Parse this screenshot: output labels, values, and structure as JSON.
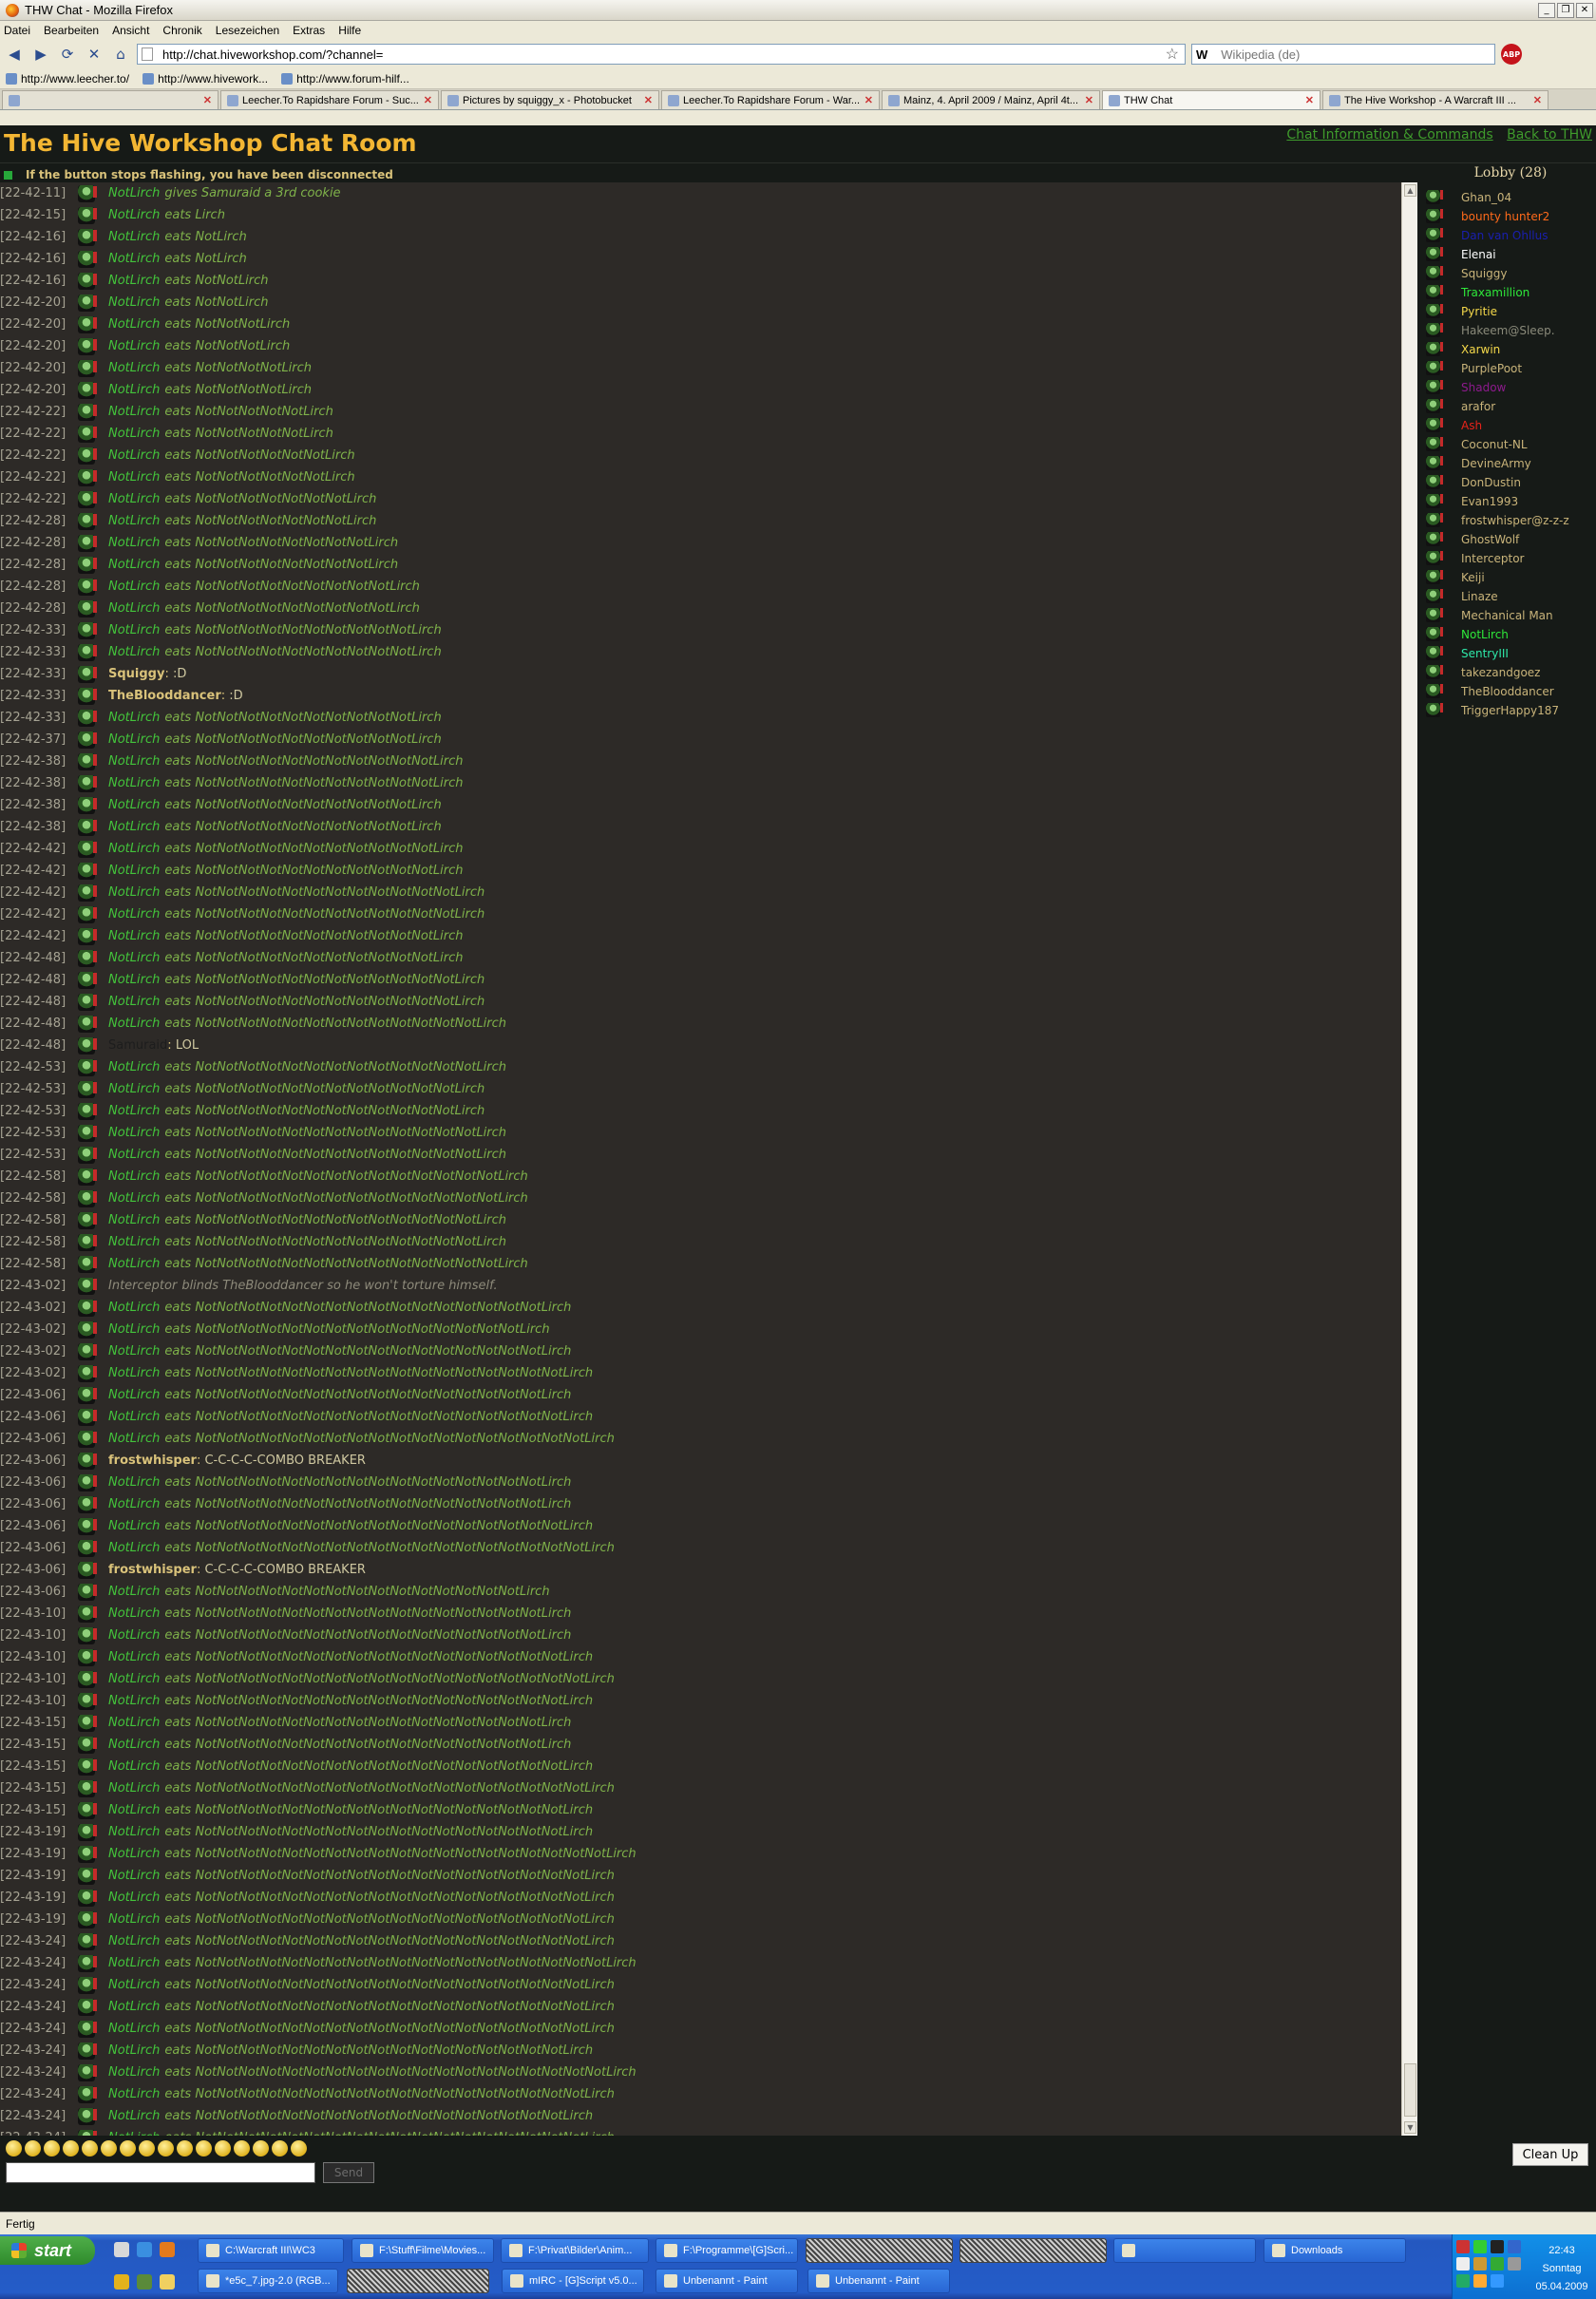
{
  "window": {
    "title": "THW Chat - Mozilla Firefox",
    "controls": [
      "_",
      "❐",
      "✕"
    ]
  },
  "menu": [
    "Datei",
    "Bearbeiten",
    "Ansicht",
    "Chronik",
    "Lesezeichen",
    "Extras",
    "Hilfe"
  ],
  "nav": {
    "url": "http://chat.hiveworkshop.com/?channel=",
    "search_engine": "W",
    "search_placeholder": "Wikipedia (de)",
    "adblock_label": "ABP"
  },
  "bookmarks": [
    "http://www.leecher.to/",
    "http://www.hivework...",
    "http://www.forum-hilf..."
  ],
  "tabs": [
    {
      "label": "",
      "active": false
    },
    {
      "label": "Leecher.To Rapidshare Forum - Suc...",
      "active": false
    },
    {
      "label": "Pictures by squiggy_x - Photobucket",
      "active": false
    },
    {
      "label": "Leecher.To Rapidshare Forum - War...",
      "active": false
    },
    {
      "label": "Mainz, 4. April 2009 / Mainz, April 4t...",
      "active": false
    },
    {
      "label": "THW Chat",
      "active": true
    },
    {
      "label": "The Hive Workshop - A Warcraft III ...",
      "active": false
    }
  ],
  "chat": {
    "title": "The Hive Workshop Chat Room",
    "links": [
      "Chat Information & Commands",
      "Back to THW"
    ],
    "notice": "If the button stops flashing, you have been disconnected",
    "lobby": "Lobby (28)"
  },
  "messages": [
    {
      "ts": "[22-42-11]",
      "kind": "emote",
      "nick": "NotLirch",
      "text": "gives Samuraid a 3rd cookie"
    },
    {
      "ts": "[22-42-15]",
      "kind": "emote",
      "nick": "NotLirch",
      "text": "eats Lirch"
    },
    {
      "ts": "[22-42-16]",
      "kind": "emote",
      "nick": "NotLirch",
      "text": "eats NotLirch"
    },
    {
      "ts": "[22-42-16]",
      "kind": "emote",
      "nick": "NotLirch",
      "text": "eats NotLirch"
    },
    {
      "ts": "[22-42-16]",
      "kind": "emote",
      "nick": "NotLirch",
      "text": "eats NotNotLirch"
    },
    {
      "ts": "[22-42-20]",
      "kind": "emote",
      "nick": "NotLirch",
      "text": "eats NotNotLirch"
    },
    {
      "ts": "[22-42-20]",
      "kind": "emote",
      "nick": "NotLirch",
      "text": "eats NotNotNotLirch"
    },
    {
      "ts": "[22-42-20]",
      "kind": "emote",
      "nick": "NotLirch",
      "text": "eats NotNotNotLirch"
    },
    {
      "ts": "[22-42-20]",
      "kind": "emote",
      "nick": "NotLirch",
      "text": "eats NotNotNotNotLirch"
    },
    {
      "ts": "[22-42-20]",
      "kind": "emote",
      "nick": "NotLirch",
      "text": "eats NotNotNotNotLirch"
    },
    {
      "ts": "[22-42-22]",
      "kind": "emote",
      "nick": "NotLirch",
      "text": "eats NotNotNotNotNotLirch"
    },
    {
      "ts": "[22-42-22]",
      "kind": "emote",
      "nick": "NotLirch",
      "text": "eats NotNotNotNotNotLirch"
    },
    {
      "ts": "[22-42-22]",
      "kind": "emote",
      "nick": "NotLirch",
      "text": "eats NotNotNotNotNotNotLirch"
    },
    {
      "ts": "[22-42-22]",
      "kind": "emote",
      "nick": "NotLirch",
      "text": "eats NotNotNotNotNotNotLirch"
    },
    {
      "ts": "[22-42-22]",
      "kind": "emote",
      "nick": "NotLirch",
      "text": "eats NotNotNotNotNotNotNotLirch"
    },
    {
      "ts": "[22-42-28]",
      "kind": "emote",
      "nick": "NotLirch",
      "text": "eats NotNotNotNotNotNotNotLirch"
    },
    {
      "ts": "[22-42-28]",
      "kind": "emote",
      "nick": "NotLirch",
      "text": "eats NotNotNotNotNotNotNotNotLirch"
    },
    {
      "ts": "[22-42-28]",
      "kind": "emote",
      "nick": "NotLirch",
      "text": "eats NotNotNotNotNotNotNotNotLirch"
    },
    {
      "ts": "[22-42-28]",
      "kind": "emote",
      "nick": "NotLirch",
      "text": "eats NotNotNotNotNotNotNotNotNotLirch"
    },
    {
      "ts": "[22-42-28]",
      "kind": "emote",
      "nick": "NotLirch",
      "text": "eats NotNotNotNotNotNotNotNotNotLirch"
    },
    {
      "ts": "[22-42-33]",
      "kind": "emote",
      "nick": "NotLirch",
      "text": "eats NotNotNotNotNotNotNotNotNotNotLirch"
    },
    {
      "ts": "[22-42-33]",
      "kind": "emote",
      "nick": "NotLirch",
      "text": "eats NotNotNotNotNotNotNotNotNotNotLirch"
    },
    {
      "ts": "[22-42-33]",
      "kind": "say",
      "nick": "Squiggy",
      "text": ":D"
    },
    {
      "ts": "[22-42-33]",
      "kind": "say",
      "nick": "TheBlooddancer",
      "text": ":D"
    },
    {
      "ts": "[22-42-33]",
      "kind": "emote",
      "nick": "NotLirch",
      "text": "eats NotNotNotNotNotNotNotNotNotNotLirch"
    },
    {
      "ts": "[22-42-37]",
      "kind": "emote",
      "nick": "NotLirch",
      "text": "eats NotNotNotNotNotNotNotNotNotNotLirch"
    },
    {
      "ts": "[22-42-38]",
      "kind": "emote",
      "nick": "NotLirch",
      "text": "eats NotNotNotNotNotNotNotNotNotNotNotLirch"
    },
    {
      "ts": "[22-42-38]",
      "kind": "emote",
      "nick": "NotLirch",
      "text": "eats NotNotNotNotNotNotNotNotNotNotNotLirch"
    },
    {
      "ts": "[22-42-38]",
      "kind": "emote",
      "nick": "NotLirch",
      "text": "eats NotNotNotNotNotNotNotNotNotNotLirch"
    },
    {
      "ts": "[22-42-38]",
      "kind": "emote",
      "nick": "NotLirch",
      "text": "eats NotNotNotNotNotNotNotNotNotNotLirch"
    },
    {
      "ts": "[22-42-42]",
      "kind": "emote",
      "nick": "NotLirch",
      "text": "eats NotNotNotNotNotNotNotNotNotNotNotLirch"
    },
    {
      "ts": "[22-42-42]",
      "kind": "emote",
      "nick": "NotLirch",
      "text": "eats NotNotNotNotNotNotNotNotNotNotNotLirch"
    },
    {
      "ts": "[22-42-42]",
      "kind": "emote",
      "nick": "NotLirch",
      "text": "eats NotNotNotNotNotNotNotNotNotNotNotNotLirch"
    },
    {
      "ts": "[22-42-42]",
      "kind": "emote",
      "nick": "NotLirch",
      "text": "eats NotNotNotNotNotNotNotNotNotNotNotNotLirch"
    },
    {
      "ts": "[22-42-42]",
      "kind": "emote",
      "nick": "NotLirch",
      "text": "eats NotNotNotNotNotNotNotNotNotNotNotLirch"
    },
    {
      "ts": "[22-42-48]",
      "kind": "emote",
      "nick": "NotLirch",
      "text": "eats NotNotNotNotNotNotNotNotNotNotNotLirch"
    },
    {
      "ts": "[22-42-48]",
      "kind": "emote",
      "nick": "NotLirch",
      "text": "eats NotNotNotNotNotNotNotNotNotNotNotNotLirch"
    },
    {
      "ts": "[22-42-48]",
      "kind": "emote",
      "nick": "NotLirch",
      "text": "eats NotNotNotNotNotNotNotNotNotNotNotNotLirch"
    },
    {
      "ts": "[22-42-48]",
      "kind": "emote",
      "nick": "NotLirch",
      "text": "eats NotNotNotNotNotNotNotNotNotNotNotNotNotLirch"
    },
    {
      "ts": "[22-42-48]",
      "kind": "say-dark",
      "nick": "Samuraid",
      "text": "LOL"
    },
    {
      "ts": "[22-42-53]",
      "kind": "emote",
      "nick": "NotLirch",
      "text": "eats NotNotNotNotNotNotNotNotNotNotNotNotNotLirch"
    },
    {
      "ts": "[22-42-53]",
      "kind": "emote",
      "nick": "NotLirch",
      "text": "eats NotNotNotNotNotNotNotNotNotNotNotNotLirch"
    },
    {
      "ts": "[22-42-53]",
      "kind": "emote",
      "nick": "NotLirch",
      "text": "eats NotNotNotNotNotNotNotNotNotNotNotNotLirch"
    },
    {
      "ts": "[22-42-53]",
      "kind": "emote",
      "nick": "NotLirch",
      "text": "eats NotNotNotNotNotNotNotNotNotNotNotNotNotLirch"
    },
    {
      "ts": "[22-42-53]",
      "kind": "emote",
      "nick": "NotLirch",
      "text": "eats NotNotNotNotNotNotNotNotNotNotNotNotNotLirch"
    },
    {
      "ts": "[22-42-58]",
      "kind": "emote",
      "nick": "NotLirch",
      "text": "eats NotNotNotNotNotNotNotNotNotNotNotNotNotNotLirch"
    },
    {
      "ts": "[22-42-58]",
      "kind": "emote",
      "nick": "NotLirch",
      "text": "eats NotNotNotNotNotNotNotNotNotNotNotNotNotNotLirch"
    },
    {
      "ts": "[22-42-58]",
      "kind": "emote",
      "nick": "NotLirch",
      "text": "eats NotNotNotNotNotNotNotNotNotNotNotNotNotLirch"
    },
    {
      "ts": "[22-42-58]",
      "kind": "emote",
      "nick": "NotLirch",
      "text": "eats NotNotNotNotNotNotNotNotNotNotNotNotNotLirch"
    },
    {
      "ts": "[22-42-58]",
      "kind": "emote",
      "nick": "NotLirch",
      "text": "eats NotNotNotNotNotNotNotNotNotNotNotNotNotNotLirch"
    },
    {
      "ts": "[22-43-02]",
      "kind": "emote-gray",
      "nick": "Interceptor",
      "text": "blinds TheBlooddancer so he won't torture himself."
    },
    {
      "ts": "[22-43-02]",
      "kind": "emote",
      "nick": "NotLirch",
      "text": "eats NotNotNotNotNotNotNotNotNotNotNotNotNotNotNotNotLirch"
    },
    {
      "ts": "[22-43-02]",
      "kind": "emote",
      "nick": "NotLirch",
      "text": "eats NotNotNotNotNotNotNotNotNotNotNotNotNotNotNotLirch"
    },
    {
      "ts": "[22-43-02]",
      "kind": "emote",
      "nick": "NotLirch",
      "text": "eats NotNotNotNotNotNotNotNotNotNotNotNotNotNotNotNotLirch"
    },
    {
      "ts": "[22-43-02]",
      "kind": "emote",
      "nick": "NotLirch",
      "text": "eats NotNotNotNotNotNotNotNotNotNotNotNotNotNotNotNotNotLirch"
    },
    {
      "ts": "[22-43-06]",
      "kind": "emote",
      "nick": "NotLirch",
      "text": "eats NotNotNotNotNotNotNotNotNotNotNotNotNotNotNotNotLirch"
    },
    {
      "ts": "[22-43-06]",
      "kind": "emote",
      "nick": "NotLirch",
      "text": "eats NotNotNotNotNotNotNotNotNotNotNotNotNotNotNotNotNotLirch"
    },
    {
      "ts": "[22-43-06]",
      "kind": "emote",
      "nick": "NotLirch",
      "text": "eats NotNotNotNotNotNotNotNotNotNotNotNotNotNotNotNotNotNotLirch"
    },
    {
      "ts": "[22-43-06]",
      "kind": "say",
      "nick": "frostwhisper",
      "text": "C-C-C-C-COMBO BREAKER"
    },
    {
      "ts": "[22-43-06]",
      "kind": "emote",
      "nick": "NotLirch",
      "text": "eats NotNotNotNotNotNotNotNotNotNotNotNotNotNotNotNotLirch"
    },
    {
      "ts": "[22-43-06]",
      "kind": "emote",
      "nick": "NotLirch",
      "text": "eats NotNotNotNotNotNotNotNotNotNotNotNotNotNotNotNotLirch"
    },
    {
      "ts": "[22-43-06]",
      "kind": "emote",
      "nick": "NotLirch",
      "text": "eats NotNotNotNotNotNotNotNotNotNotNotNotNotNotNotNotNotLirch"
    },
    {
      "ts": "[22-43-06]",
      "kind": "emote",
      "nick": "NotLirch",
      "text": "eats NotNotNotNotNotNotNotNotNotNotNotNotNotNotNotNotNotNotLirch"
    },
    {
      "ts": "[22-43-06]",
      "kind": "say",
      "nick": "frostwhisper",
      "text": "C-C-C-C-COMBO BREAKER"
    },
    {
      "ts": "[22-43-06]",
      "kind": "emote",
      "nick": "NotLirch",
      "text": "eats NotNotNotNotNotNotNotNotNotNotNotNotNotNotNotLirch"
    },
    {
      "ts": "[22-43-10]",
      "kind": "emote",
      "nick": "NotLirch",
      "text": "eats NotNotNotNotNotNotNotNotNotNotNotNotNotNotNotNotLirch"
    },
    {
      "ts": "[22-43-10]",
      "kind": "emote",
      "nick": "NotLirch",
      "text": "eats NotNotNotNotNotNotNotNotNotNotNotNotNotNotNotNotLirch"
    },
    {
      "ts": "[22-43-10]",
      "kind": "emote",
      "nick": "NotLirch",
      "text": "eats NotNotNotNotNotNotNotNotNotNotNotNotNotNotNotNotNotLirch"
    },
    {
      "ts": "[22-43-10]",
      "kind": "emote",
      "nick": "NotLirch",
      "text": "eats NotNotNotNotNotNotNotNotNotNotNotNotNotNotNotNotNotNotLirch"
    },
    {
      "ts": "[22-43-10]",
      "kind": "emote",
      "nick": "NotLirch",
      "text": "eats NotNotNotNotNotNotNotNotNotNotNotNotNotNotNotNotNotLirch"
    },
    {
      "ts": "[22-43-15]",
      "kind": "emote",
      "nick": "NotLirch",
      "text": "eats NotNotNotNotNotNotNotNotNotNotNotNotNotNotNotNotLirch"
    },
    {
      "ts": "[22-43-15]",
      "kind": "emote",
      "nick": "NotLirch",
      "text": "eats NotNotNotNotNotNotNotNotNotNotNotNotNotNotNotNotLirch"
    },
    {
      "ts": "[22-43-15]",
      "kind": "emote",
      "nick": "NotLirch",
      "text": "eats NotNotNotNotNotNotNotNotNotNotNotNotNotNotNotNotNotLirch"
    },
    {
      "ts": "[22-43-15]",
      "kind": "emote",
      "nick": "NotLirch",
      "text": "eats NotNotNotNotNotNotNotNotNotNotNotNotNotNotNotNotNotNotLirch"
    },
    {
      "ts": "[22-43-15]",
      "kind": "emote",
      "nick": "NotLirch",
      "text": "eats NotNotNotNotNotNotNotNotNotNotNotNotNotNotNotNotNotLirch"
    },
    {
      "ts": "[22-43-19]",
      "kind": "emote",
      "nick": "NotLirch",
      "text": "eats NotNotNotNotNotNotNotNotNotNotNotNotNotNotNotNotNotLirch"
    },
    {
      "ts": "[22-43-19]",
      "kind": "emote",
      "nick": "NotLirch",
      "text": "eats NotNotNotNotNotNotNotNotNotNotNotNotNotNotNotNotNotNotNotLirch"
    },
    {
      "ts": "[22-43-19]",
      "kind": "emote",
      "nick": "NotLirch",
      "text": "eats NotNotNotNotNotNotNotNotNotNotNotNotNotNotNotNotNotNotLirch"
    },
    {
      "ts": "[22-43-19]",
      "kind": "emote",
      "nick": "NotLirch",
      "text": "eats NotNotNotNotNotNotNotNotNotNotNotNotNotNotNotNotNotNotLirch"
    },
    {
      "ts": "[22-43-19]",
      "kind": "emote",
      "nick": "NotLirch",
      "text": "eats NotNotNotNotNotNotNotNotNotNotNotNotNotNotNotNotNotNotLirch"
    },
    {
      "ts": "[22-43-24]",
      "kind": "emote",
      "nick": "NotLirch",
      "text": "eats NotNotNotNotNotNotNotNotNotNotNotNotNotNotNotNotNotNotLirch"
    },
    {
      "ts": "[22-43-24]",
      "kind": "emote",
      "nick": "NotLirch",
      "text": "eats NotNotNotNotNotNotNotNotNotNotNotNotNotNotNotNotNotNotNotLirch"
    },
    {
      "ts": "[22-43-24]",
      "kind": "emote",
      "nick": "NotLirch",
      "text": "eats NotNotNotNotNotNotNotNotNotNotNotNotNotNotNotNotNotNotLirch"
    },
    {
      "ts": "[22-43-24]",
      "kind": "emote",
      "nick": "NotLirch",
      "text": "eats NotNotNotNotNotNotNotNotNotNotNotNotNotNotNotNotNotNotLirch"
    },
    {
      "ts": "[22-43-24]",
      "kind": "emote",
      "nick": "NotLirch",
      "text": "eats NotNotNotNotNotNotNotNotNotNotNotNotNotNotNotNotNotNotLirch"
    },
    {
      "ts": "[22-43-24]",
      "kind": "emote",
      "nick": "NotLirch",
      "text": "eats NotNotNotNotNotNotNotNotNotNotNotNotNotNotNotNotNotLirch"
    },
    {
      "ts": "[22-43-24]",
      "kind": "emote",
      "nick": "NotLirch",
      "text": "eats NotNotNotNotNotNotNotNotNotNotNotNotNotNotNotNotNotNotNotLirch"
    },
    {
      "ts": "[22-43-24]",
      "kind": "emote",
      "nick": "NotLirch",
      "text": "eats NotNotNotNotNotNotNotNotNotNotNotNotNotNotNotNotNotNotLirch"
    },
    {
      "ts": "[22-43-24]",
      "kind": "emote",
      "nick": "NotLirch",
      "text": "eats NotNotNotNotNotNotNotNotNotNotNotNotNotNotNotNotNotLirch"
    },
    {
      "ts": "[22-43-24]",
      "kind": "emote",
      "nick": "NotLirch",
      "text": "eats NotNotNotNotNotNotNotNotNotNotNotNotNotNotNotNotNotNotLirch"
    }
  ],
  "users": [
    {
      "name": "Ghan_04",
      "color": "#c9b47a"
    },
    {
      "name": "bounty hunter2",
      "color": "#ff6a1a"
    },
    {
      "name": "Dan van Ohllus",
      "color": "#1a1fb0"
    },
    {
      "name": "Elenai",
      "color": "#ffffff"
    },
    {
      "name": "Squiggy",
      "color": "#c9b47a"
    },
    {
      "name": "Traxamillion",
      "color": "#2ee83a"
    },
    {
      "name": "Pyritie",
      "color": "#f5d94a"
    },
    {
      "name": "Hakeem@Sleep.",
      "color": "#8a8a7a"
    },
    {
      "name": "Xarwin",
      "color": "#f5d94a"
    },
    {
      "name": "PurplePoot",
      "color": "#c9b47a"
    },
    {
      "name": "Shadow",
      "color": "#8d1a8d"
    },
    {
      "name": "arafor",
      "color": "#c9b47a"
    },
    {
      "name": "Ash",
      "color": "#e8231a"
    },
    {
      "name": "Coconut-NL",
      "color": "#c9b47a"
    },
    {
      "name": "DevineArmy",
      "color": "#c9b47a"
    },
    {
      "name": "DonDustin",
      "color": "#c9b47a"
    },
    {
      "name": "Evan1993",
      "color": "#c9b47a"
    },
    {
      "name": "frostwhisper@z-z-z",
      "color": "#c9b47a"
    },
    {
      "name": "GhostWolf",
      "color": "#c9b47a"
    },
    {
      "name": "Interceptor",
      "color": "#c9b47a"
    },
    {
      "name": "Keiji",
      "color": "#c9b47a"
    },
    {
      "name": "Linaze",
      "color": "#c9b47a"
    },
    {
      "name": "Mechanical Man",
      "color": "#c9b47a"
    },
    {
      "name": "NotLirch",
      "color": "#2ee83a"
    },
    {
      "name": "SentryIII",
      "color": "#2ee8a8"
    },
    {
      "name": "takezandgoez",
      "color": "#c9b47a"
    },
    {
      "name": "TheBlooddancer",
      "color": "#c9b47a"
    },
    {
      "name": "TriggerHappy187",
      "color": "#c9b47a"
    }
  ],
  "input": {
    "value": "",
    "send_label": "Send",
    "cleanup_label": "Clean Up"
  },
  "statusbar": {
    "text": "Fertig"
  },
  "taskbar": {
    "start_label": "start",
    "row1": [
      {
        "label": "C:\\Warcraft III\\WC3",
        "blurred": false
      },
      {
        "label": "F:\\Stuff\\Filme\\Movies...",
        "blurred": false
      },
      {
        "label": "F:\\Privat\\Bilder\\Anim...",
        "blurred": false
      },
      {
        "label": "F:\\Programme\\[G]Scri...",
        "blurred": false
      },
      {
        "label": "",
        "blurred": true
      },
      {
        "label": "",
        "blurred": true
      },
      {
        "label": "",
        "blurred": false
      },
      {
        "label": "Downloads",
        "blurred": false
      }
    ],
    "row2": [
      {
        "label": "*e5c_7.jpg-2.0 (RGB...",
        "blurred": false
      },
      {
        "label": "",
        "blurred": true
      },
      {
        "label": "mIRC - [G]Script v5.0...",
        "blurred": false
      },
      {
        "label": "Unbenannt - Paint",
        "blurred": false
      },
      {
        "label": "Unbenannt - Paint",
        "blurred": false
      }
    ],
    "clock": {
      "time": "22:43",
      "day": "Sonntag",
      "date": "05.04.2009"
    }
  }
}
